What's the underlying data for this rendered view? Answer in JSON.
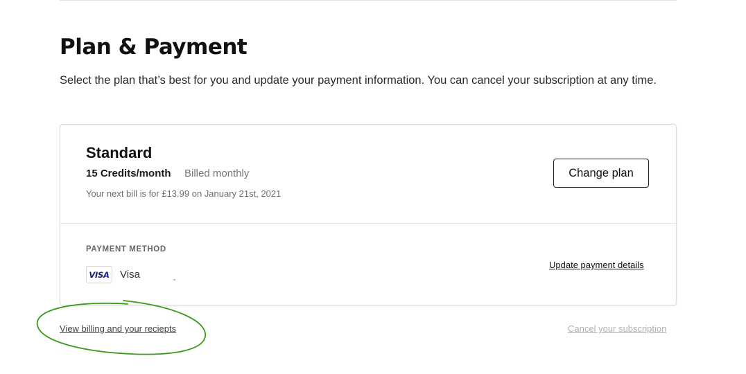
{
  "header": {
    "title": "Plan & Payment",
    "description": "Select the plan that’s best for you and update your payment information. You can cancel your subscription at any time."
  },
  "plan": {
    "name": "Standard",
    "credits": "15 Credits/month",
    "billing": "Billed monthly",
    "next_bill": "Your next bill is for £13.99 on January 21st, 2021",
    "change_plan_label": "Change plan"
  },
  "payment": {
    "section_label": "PAYMENT METHOD",
    "card_brand_badge": "VISA",
    "card_brand_name": "Visa",
    "update_link": "Update payment details"
  },
  "footer": {
    "view_billing_link": "View billing and your reciepts",
    "cancel_link": "Cancel your subscription"
  },
  "colors": {
    "annotation": "#3a9a1a",
    "visa_blue": "#1a1f71",
    "muted_link": "#b0b0b0"
  }
}
